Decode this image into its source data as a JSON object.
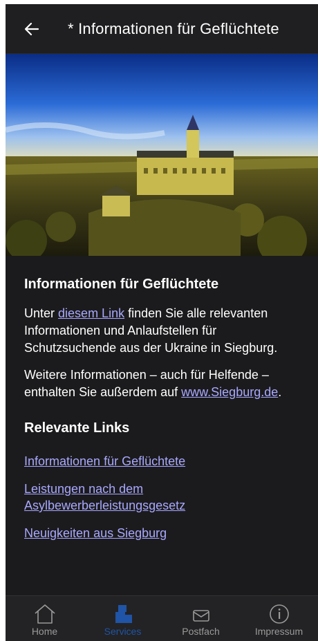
{
  "header": {
    "title": "* Informationen für Geflüchtete"
  },
  "section1": {
    "heading": "Informationen für Geflüchtete",
    "p1_before": "Unter ",
    "p1_link": "diesem Link",
    "p1_after": " finden Sie alle relevanten Informationen und Anlaufstellen für Schutzsuchende aus der Ukraine in Siegburg.",
    "p2_text": "Weitere Informationen – auch für Helfende – enthalten Sie außerdem auf ",
    "p2_link": "www.Siegburg.de",
    "p2_end": "."
  },
  "section2": {
    "heading": "Relevante Links",
    "links": [
      "Informationen für Geflüchtete",
      "Leistungen nach dem Asylbewerberleistungsgesetz",
      "Neuigkeiten aus Siegburg"
    ]
  },
  "tabs": [
    {
      "label": "Home",
      "icon": "home-icon"
    },
    {
      "label": "Services",
      "icon": "services-icon"
    },
    {
      "label": "Postfach",
      "icon": "mail-icon"
    },
    {
      "label": "Impressum",
      "icon": "info-icon"
    }
  ],
  "colors": {
    "link": "#a9a8ff",
    "active_tab": "#1f54a6",
    "background": "#1b1b1d"
  }
}
